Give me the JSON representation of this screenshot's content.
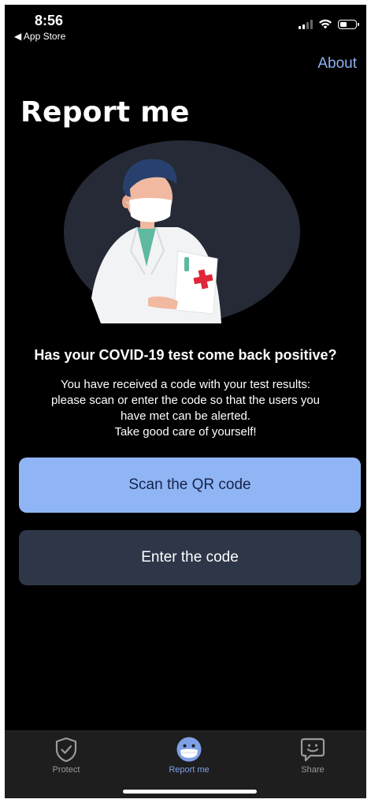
{
  "status_bar": {
    "time": "8:56",
    "back_label": "◀ App Store"
  },
  "header": {
    "about_label": "About",
    "title": "Report me"
  },
  "illustration": {
    "icon": "doctor-illustration"
  },
  "main": {
    "question": "Has your COVID-19 test come back positive?",
    "body_lines": [
      "You have received a code with your test results:",
      "please scan or enter the code so that the users you",
      "have met can be alerted.",
      "Take good care of yourself!"
    ],
    "scan_button_label": "Scan the QR code",
    "enter_button_label": "Enter the code"
  },
  "tabbar": {
    "tabs": [
      {
        "label": "Protect",
        "icon": "shield-check-icon",
        "active": false
      },
      {
        "label": "Report me",
        "icon": "masked-face-icon",
        "active": true
      },
      {
        "label": "Share",
        "icon": "speech-bubble-smile-icon",
        "active": false
      }
    ]
  },
  "colors": {
    "background": "#000000",
    "accent": "#8fb5f5",
    "secondary_button": "#2d3748",
    "link": "#8fb0f0",
    "tab_active": "#7fa0e6"
  }
}
